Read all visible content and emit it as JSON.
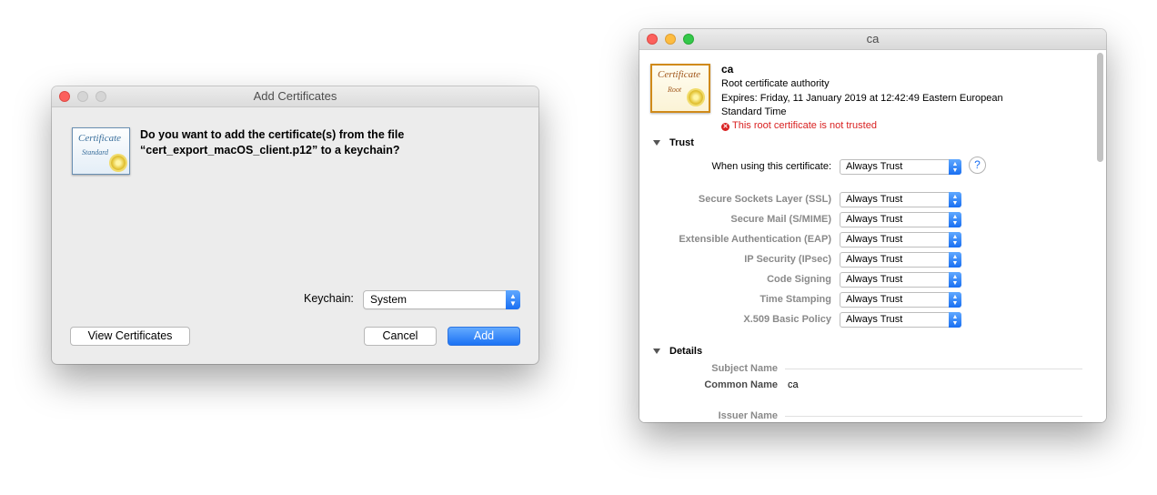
{
  "dialog": {
    "title": "Add Certificates",
    "icon": "certificate-standard-icon",
    "icon_caption_1": "Certificate",
    "icon_caption_2": "Standard",
    "question_line1": "Do you want to add the certificate(s) from the file",
    "question_line2": "“cert_export_macOS_client.p12” to a keychain?",
    "keychain_label": "Keychain:",
    "keychain_value": "System",
    "view_button": "View Certificates",
    "cancel_button": "Cancel",
    "add_button": "Add"
  },
  "cert_window": {
    "title": "ca",
    "icon": "certificate-root-icon",
    "icon_caption_1": "Certificate",
    "icon_caption_2": "Root",
    "name": "ca",
    "kind": "Root certificate authority",
    "expires_line1": "Expires: Friday, 11 January 2019 at 12:42:49 Eastern European",
    "expires_line2": "Standard Time",
    "warning": "This root certificate is not trusted",
    "trust_section": "Trust",
    "when_using_label": "When using this certificate:",
    "when_using_value": "Always Trust",
    "help": "?",
    "policies": [
      {
        "label": "Secure Sockets Layer (SSL)",
        "value": "Always Trust"
      },
      {
        "label": "Secure Mail (S/MIME)",
        "value": "Always Trust"
      },
      {
        "label": "Extensible Authentication (EAP)",
        "value": "Always Trust"
      },
      {
        "label": "IP Security (IPsec)",
        "value": "Always Trust"
      },
      {
        "label": "Code Signing",
        "value": "Always Trust"
      },
      {
        "label": "Time Stamping",
        "value": "Always Trust"
      },
      {
        "label": "X.509 Basic Policy",
        "value": "Always Trust"
      }
    ],
    "details_section": "Details",
    "subject_name_label": "Subject Name",
    "common_name_label": "Common Name",
    "common_name_value": "ca",
    "issuer_name_label": "Issuer Name"
  }
}
